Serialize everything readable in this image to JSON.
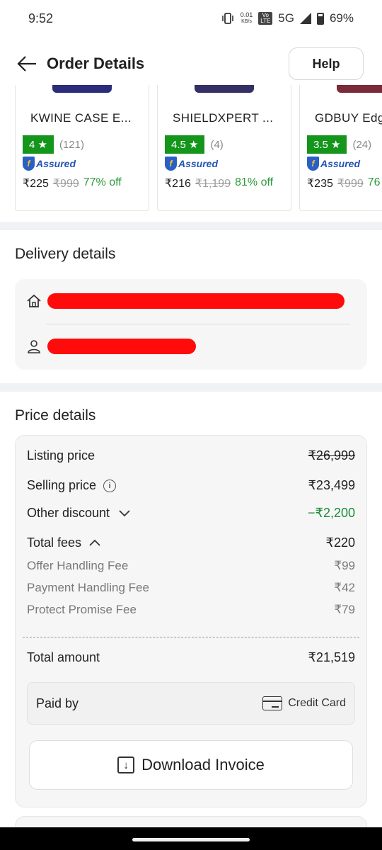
{
  "status_bar": {
    "time": "9:52",
    "speed_value": "0.01",
    "speed_unit": "KB/s",
    "volte": "Vo LTE",
    "network": "5G",
    "battery": "69%"
  },
  "header": {
    "title": "Order Details",
    "help_label": "Help"
  },
  "products": [
    {
      "name": "KWINE CASE E...",
      "rating": "4 ★",
      "count": "(121)",
      "assured": "Assured",
      "price": "₹225",
      "mrp": "₹999",
      "off": "77% off",
      "color": "#2b2d7a"
    },
    {
      "name": "SHIELDXPERT ...",
      "rating": "4.5 ★",
      "count": "(4)",
      "assured": "Assured",
      "price": "₹216",
      "mrp": "₹1,199",
      "off": "81% off",
      "color": "#343064"
    },
    {
      "name": "GDBUY Edg",
      "rating": "3.5 ★",
      "count": "(24)",
      "assured": "Assured",
      "price": "₹235",
      "mrp": "₹999",
      "off": "76",
      "color": "#7a2a38"
    }
  ],
  "delivery": {
    "title": "Delivery details"
  },
  "price_details": {
    "title": "Price details",
    "listing_label": "Listing price",
    "listing_value": "₹26,999",
    "selling_label": "Selling price",
    "selling_value": "₹23,499",
    "discount_label": "Other discount",
    "discount_value": "−₹2,200",
    "fees_label": "Total fees",
    "fees_value": "₹220",
    "fee_items": [
      {
        "label": "Offer Handling Fee",
        "value": "₹99"
      },
      {
        "label": "Payment Handling Fee",
        "value": "₹42"
      },
      {
        "label": "Protect Promise Fee",
        "value": "₹79"
      }
    ],
    "total_label": "Total amount",
    "total_value": "₹21,519",
    "paid_by_label": "Paid by",
    "paid_by_method": "Credit Card",
    "download_label": "Download Invoice"
  },
  "colors": {
    "rating_green": "#14951b",
    "discount_green": "#1b8a3a",
    "redaction": "#ff0b0b"
  }
}
